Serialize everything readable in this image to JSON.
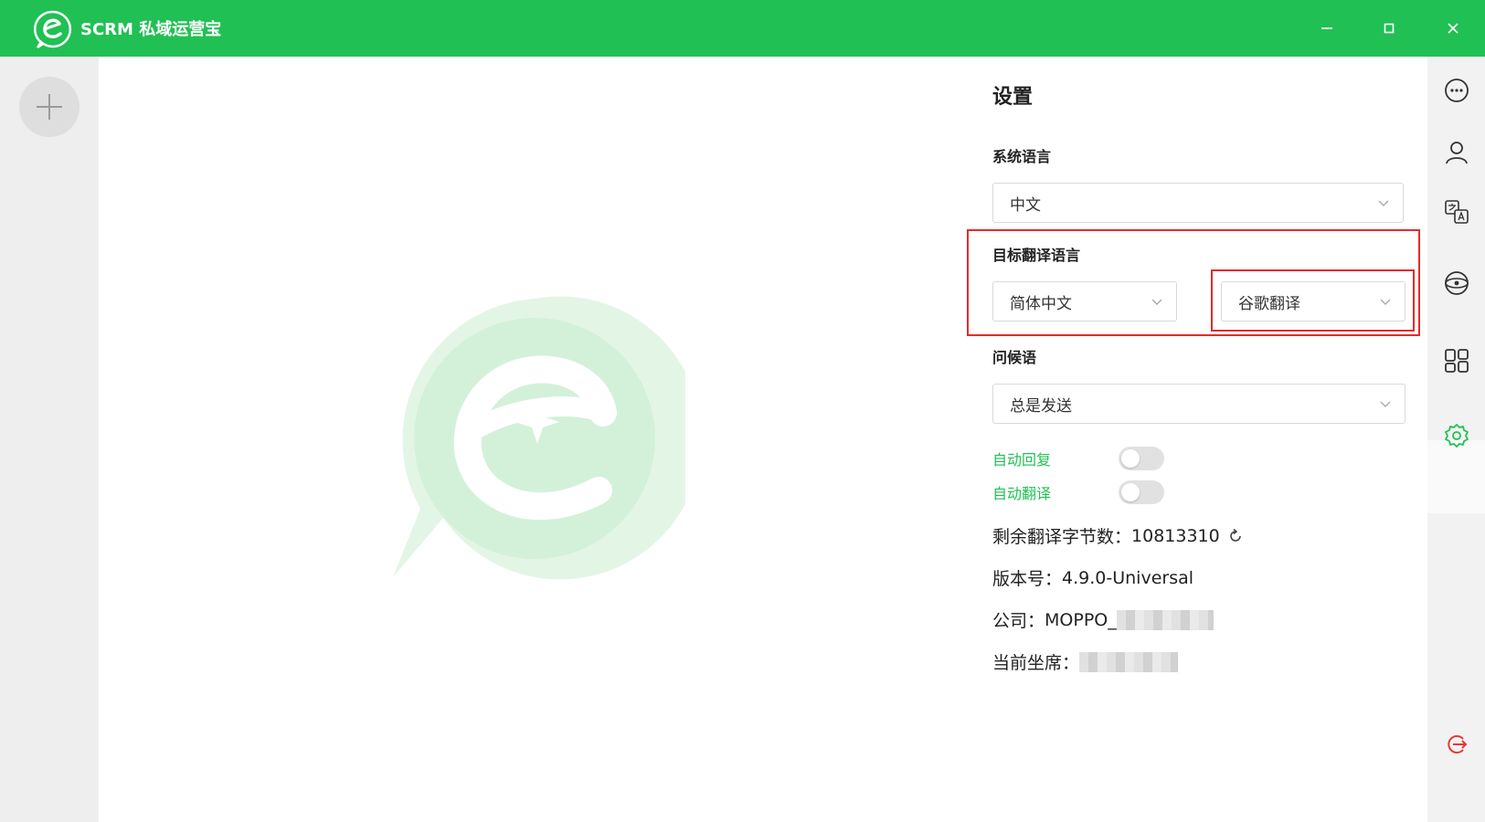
{
  "app": {
    "title": "SCRM 私域运营宝"
  },
  "window_controls": {
    "minimize": "minimize-icon",
    "maximize": "maximize-icon",
    "close": "close-icon"
  },
  "settings": {
    "title": "设置",
    "system_language": {
      "label": "系统语言",
      "value": "中文"
    },
    "target_language": {
      "label": "目标翻译语言",
      "language": "简体中文",
      "engine": "谷歌翻译"
    },
    "greeting": {
      "label": "问候语",
      "value": "总是发送"
    },
    "auto_reply": {
      "label": "自动回复",
      "on": false
    },
    "auto_translate": {
      "label": "自动翻译",
      "on": false
    },
    "remaining_bytes": {
      "label": "剩余翻译字节数：",
      "value": "10813310"
    },
    "version": {
      "label": "版本号：",
      "value": "4.9.0-Universal"
    },
    "company": {
      "label": "公司：",
      "value": "MOPPO_"
    },
    "current_seat": {
      "label": "当前坐席："
    }
  },
  "right_sidebar": {
    "icons": [
      "more-icon",
      "user-icon",
      "translate-icon",
      "ai-icon",
      "apps-icon",
      "settings-icon",
      "logout-icon"
    ]
  },
  "colors": {
    "brand": "#21c054",
    "highlight": "#e42a2a",
    "logout": "#e53935"
  }
}
